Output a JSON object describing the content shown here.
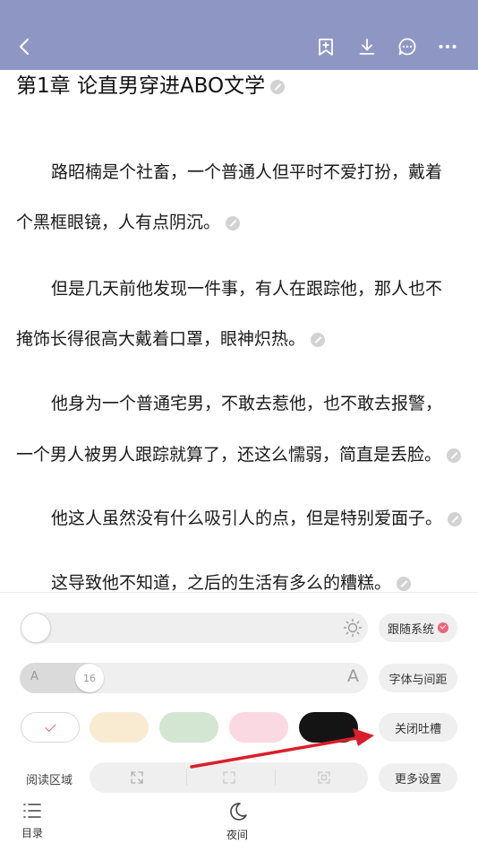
{
  "header": {
    "back_icon": "back-arrow-icon",
    "bookmark_icon": "bookmark-add-icon",
    "download_icon": "download-icon",
    "comment_icon": "comment-bubble-icon",
    "more_icon": "more-dots-icon",
    "bar_color": "#8e97c4"
  },
  "chapter": {
    "title": "第1章 论直男穿进ABO文学",
    "lines": [
      "路昭楠是个社畜，一个普通人但平时不爱打扮，戴着",
      "个黑框眼镜，人有点阴沉。",
      "但是几天前他发现一件事，有人在跟踪他，那人也不",
      "掩饰长得很高大戴着口罩，眼神炽热。",
      "他身为一个普通宅男，不敢去惹他，也不敢去报警，",
      "一个男人被男人跟踪就算了，还这么懦弱，简直是丢脸。",
      "他这人虽然没有什么吸引人的点，但是特别爱面子。",
      "这导致他不知道，之后的生活有多么的糟糕。"
    ]
  },
  "settings": {
    "brightness_follow_label": "跟随系统",
    "font_small": "A",
    "font_large": "A",
    "font_size": "16",
    "font_spacing_label": "字体与间距",
    "close_comments_label": "关闭吐槽",
    "reading_area_label": "阅读区域",
    "more_settings_label": "更多设置",
    "accent_color": "#f0627a",
    "themes": [
      "white",
      "cream",
      "green",
      "pink",
      "black"
    ]
  },
  "bottom_nav": {
    "catalog_label": "目录",
    "night_label": "夜间"
  }
}
